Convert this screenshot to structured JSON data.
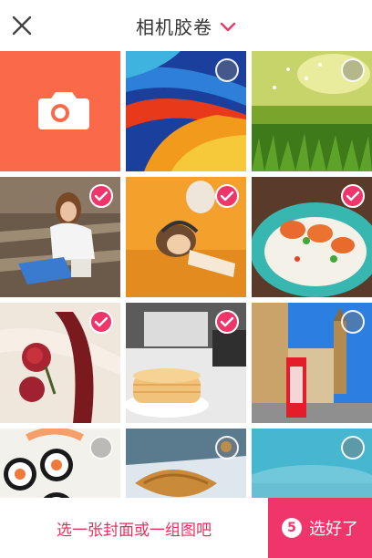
{
  "header": {
    "title": "相机胶卷",
    "close_icon": "close-icon",
    "dropdown_icon": "chevron-down-icon"
  },
  "grid": {
    "camera_tile_icon": "camera-icon",
    "photos": [
      {
        "subject": "abstract-swirl",
        "selected": false
      },
      {
        "subject": "grass-dandelions",
        "selected": false
      },
      {
        "subject": "girl-on-bench",
        "selected": true
      },
      {
        "subject": "girl-with-headphones",
        "selected": true
      },
      {
        "subject": "shrimp-rice-plate",
        "selected": true
      },
      {
        "subject": "roses-ribbon",
        "selected": true
      },
      {
        "subject": "pancakes-desk",
        "selected": true
      },
      {
        "subject": "london-phone-booth",
        "selected": false
      },
      {
        "subject": "sushi-rolls",
        "selected": false
      },
      {
        "subject": "croissants",
        "selected": false
      },
      {
        "subject": "misty-blue",
        "selected": false
      }
    ]
  },
  "footer": {
    "hint": "选一张封面或一组图吧",
    "count": "5",
    "done_label": "选好了"
  },
  "colors": {
    "accent": "#f0356a",
    "camera_tile": "#fb6a48"
  }
}
